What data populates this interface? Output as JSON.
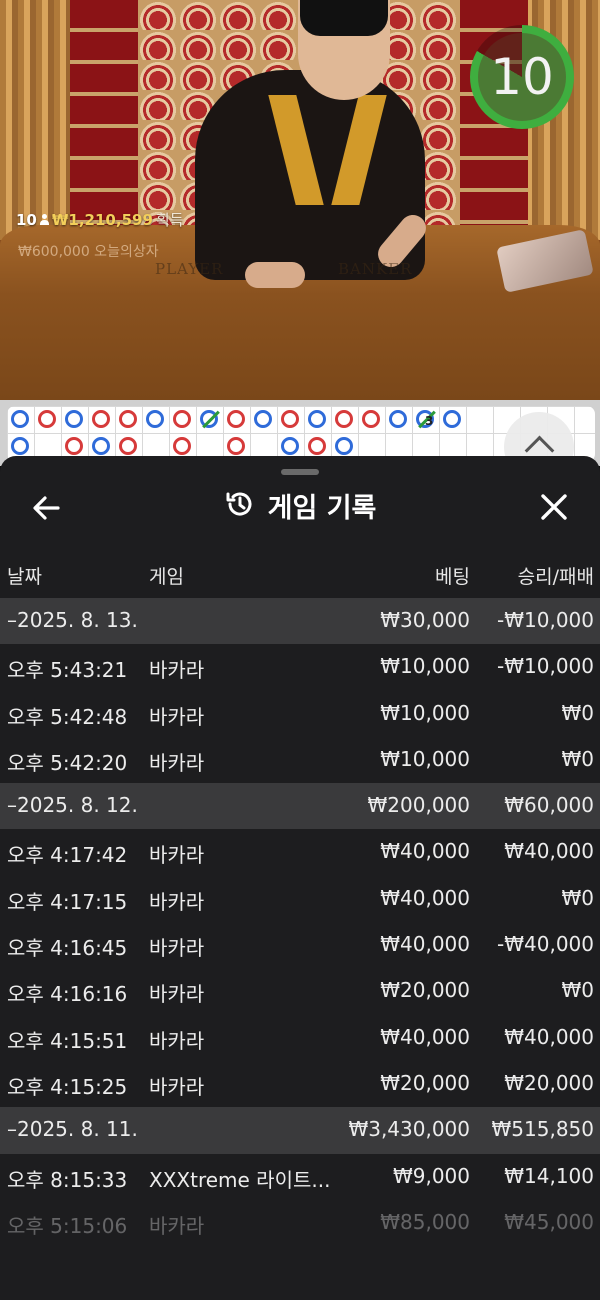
{
  "video": {
    "timer": "10",
    "winners": {
      "count": "10",
      "amount": "₩1,210,599",
      "label": "획득"
    },
    "big_win": "₩600,000  오늘의상자",
    "table_labels": {
      "player": "PLAYER",
      "banker": "BANKER"
    }
  },
  "road": {
    "row1": [
      "b",
      "r",
      "b",
      "r",
      "r",
      "b",
      "r",
      "g",
      "r",
      "b",
      "r",
      "b",
      "r",
      "r",
      "b",
      "g",
      "b"
    ],
    "row2": [
      "b",
      "",
      "r",
      "b",
      "r",
      "",
      "r",
      "",
      "r",
      "",
      "b",
      "r",
      "b"
    ],
    "marker": "3"
  },
  "sheet": {
    "title": "게임 기록",
    "back_icon": "arrow-left-icon",
    "history_icon": "history-icon",
    "close_icon": "close-icon",
    "columns": {
      "date": "날짜",
      "game": "게임",
      "bet": "베팅",
      "winloss": "승리/패배"
    },
    "rows": [
      {
        "type": "group",
        "date": "–2025. 8. 13.",
        "game": "",
        "bet": "₩30,000",
        "winloss": "-₩10,000"
      },
      {
        "type": "item",
        "date": "오후 5:43:21",
        "game": "바카라",
        "bet": "₩10,000",
        "winloss": "-₩10,000"
      },
      {
        "type": "item",
        "date": "오후 5:42:48",
        "game": "바카라",
        "bet": "₩10,000",
        "winloss": "₩0"
      },
      {
        "type": "item",
        "date": "오후 5:42:20",
        "game": "바카라",
        "bet": "₩10,000",
        "winloss": "₩0"
      },
      {
        "type": "group",
        "date": "–2025. 8. 12.",
        "game": "",
        "bet": "₩200,000",
        "winloss": "₩60,000"
      },
      {
        "type": "item",
        "date": "오후 4:17:42",
        "game": "바카라",
        "bet": "₩40,000",
        "winloss": "₩40,000"
      },
      {
        "type": "item",
        "date": "오후 4:17:15",
        "game": "바카라",
        "bet": "₩40,000",
        "winloss": "₩0"
      },
      {
        "type": "item",
        "date": "오후 4:16:45",
        "game": "바카라",
        "bet": "₩40,000",
        "winloss": "-₩40,000"
      },
      {
        "type": "item",
        "date": "오후 4:16:16",
        "game": "바카라",
        "bet": "₩20,000",
        "winloss": "₩0"
      },
      {
        "type": "item",
        "date": "오후 4:15:51",
        "game": "바카라",
        "bet": "₩40,000",
        "winloss": "₩40,000"
      },
      {
        "type": "item",
        "date": "오후 4:15:25",
        "game": "바카라",
        "bet": "₩20,000",
        "winloss": "₩20,000"
      },
      {
        "type": "group",
        "date": "–2025. 8. 11.",
        "game": "",
        "bet": "₩3,430,000",
        "winloss": "₩515,850"
      },
      {
        "type": "item",
        "date": "오후 8:15:33",
        "game": "XXXtreme 라이트...",
        "bet": "₩9,000",
        "winloss": "₩14,100"
      },
      {
        "type": "item",
        "faded": true,
        "date": "오후 5:15:06",
        "game": "바카라",
        "bet": "₩85,000",
        "winloss": "₩45,000"
      }
    ]
  }
}
